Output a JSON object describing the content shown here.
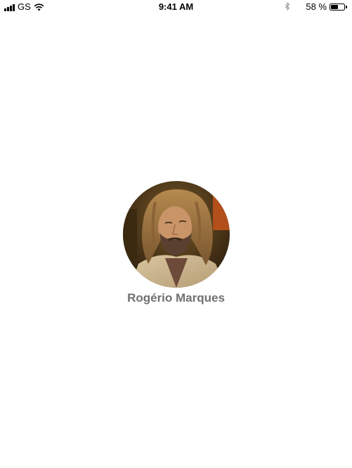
{
  "status_bar": {
    "carrier": "GS",
    "time": "9:41 AM",
    "battery_percent": "58 %",
    "battery_level": 0.58,
    "icons": [
      "signal-icon",
      "wifi-icon",
      "bluetooth-icon",
      "battery-icon"
    ]
  },
  "profile": {
    "name": "Rogério Marques",
    "avatar": "avatar-photo"
  },
  "colors": {
    "background": "#ffffff",
    "name_text": "#707070"
  }
}
